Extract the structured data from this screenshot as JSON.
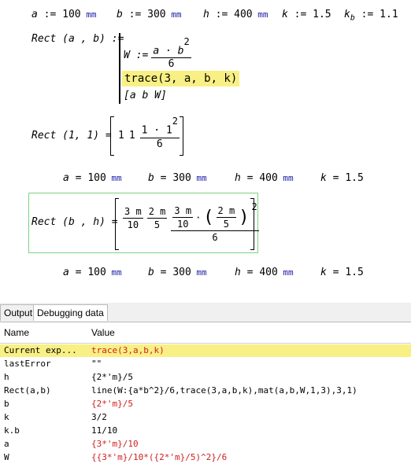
{
  "worksheet": {
    "defs1": [
      {
        "name": "a",
        "op": ":=",
        "value": "100",
        "unit": "mm"
      },
      {
        "name": "b",
        "op": ":=",
        "value": "300",
        "unit": "mm"
      },
      {
        "name": "h",
        "op": ":=",
        "value": "400",
        "unit": "mm"
      },
      {
        "name": "k",
        "op": ":=",
        "value": "1.5",
        "unit": ""
      },
      {
        "name": "k",
        "sub": "b",
        "op": ":=",
        "value": "1.1",
        "unit": ""
      }
    ],
    "rect_def": {
      "head": "Rect (a , b) :=",
      "w_assign": "W :=",
      "w_num": "a · b",
      "w_exp": "2",
      "w_den": "6",
      "trace_line": "trace(3, a, b, k)",
      "result_line": "[a  b  W]"
    },
    "rect11": {
      "head": "Rect (1, 1) =",
      "v1": "1",
      "v2": "1",
      "frac_num": "1 · 1",
      "frac_exp": "2",
      "frac_den": "6"
    },
    "defs2": [
      {
        "name": "a",
        "op": "=",
        "value": "100",
        "unit": "mm"
      },
      {
        "name": "b",
        "op": "=",
        "value": "300",
        "unit": "mm"
      },
      {
        "name": "h",
        "op": "=",
        "value": "400",
        "unit": "mm"
      },
      {
        "name": "k",
        "op": "=",
        "value": "1.5",
        "unit": ""
      }
    ],
    "rectbh": {
      "head": "Rect (b , h) =",
      "f1_num": "3 m",
      "f1_den": "10",
      "f2_num": "2 m",
      "f2_den": "5",
      "f3a_num": "3 m",
      "f3a_den": "10",
      "f3b_num": "2 m",
      "f3b_den": "5",
      "f3_exp": "2",
      "f3_den": "6"
    },
    "defs3": [
      {
        "name": "a",
        "op": "=",
        "value": "100",
        "unit": "mm"
      },
      {
        "name": "b",
        "op": "=",
        "value": "300",
        "unit": "mm"
      },
      {
        "name": "h",
        "op": "=",
        "value": "400",
        "unit": "mm"
      },
      {
        "name": "k",
        "op": "=",
        "value": "1.5",
        "unit": ""
      }
    ]
  },
  "panel": {
    "tabs": [
      "Output",
      "Debugging data"
    ],
    "active_tab": "Debugging data",
    "columns": [
      "Name",
      "Value"
    ],
    "rows": [
      {
        "name": "Current exp...",
        "value": "trace(3,a,b,k)",
        "color": "#d02020",
        "selected": true
      },
      {
        "name": "lastError",
        "value": "\"\"",
        "color": "#000000",
        "selected": false
      },
      {
        "name": "h",
        "value": "{2*'m}/5",
        "color": "#000000",
        "selected": false
      },
      {
        "name": "Rect(a,b)",
        "value": "line(W:{a*b^2}/6,trace(3,a,b,k),mat(a,b,W,1,3),3,1)",
        "color": "#000000",
        "selected": false
      },
      {
        "name": "b",
        "value": "{2*'m}/5",
        "color": "#d02020",
        "selected": false
      },
      {
        "name": "k",
        "value": "3/2",
        "color": "#000000",
        "selected": false
      },
      {
        "name": "k.b",
        "value": "11/10",
        "color": "#000000",
        "selected": false
      },
      {
        "name": "a",
        "value": "{3*'m}/10",
        "color": "#d02020",
        "selected": false
      },
      {
        "name": "W",
        "value": "{{3*'m}/10*({2*'m}/5)^2}/6",
        "color": "#d02020",
        "selected": false
      }
    ]
  },
  "colors": {
    "highlight": "#f8f084",
    "region_border": "#7ed27e",
    "unit": "#1a1aa6",
    "value_red": "#d02020"
  }
}
